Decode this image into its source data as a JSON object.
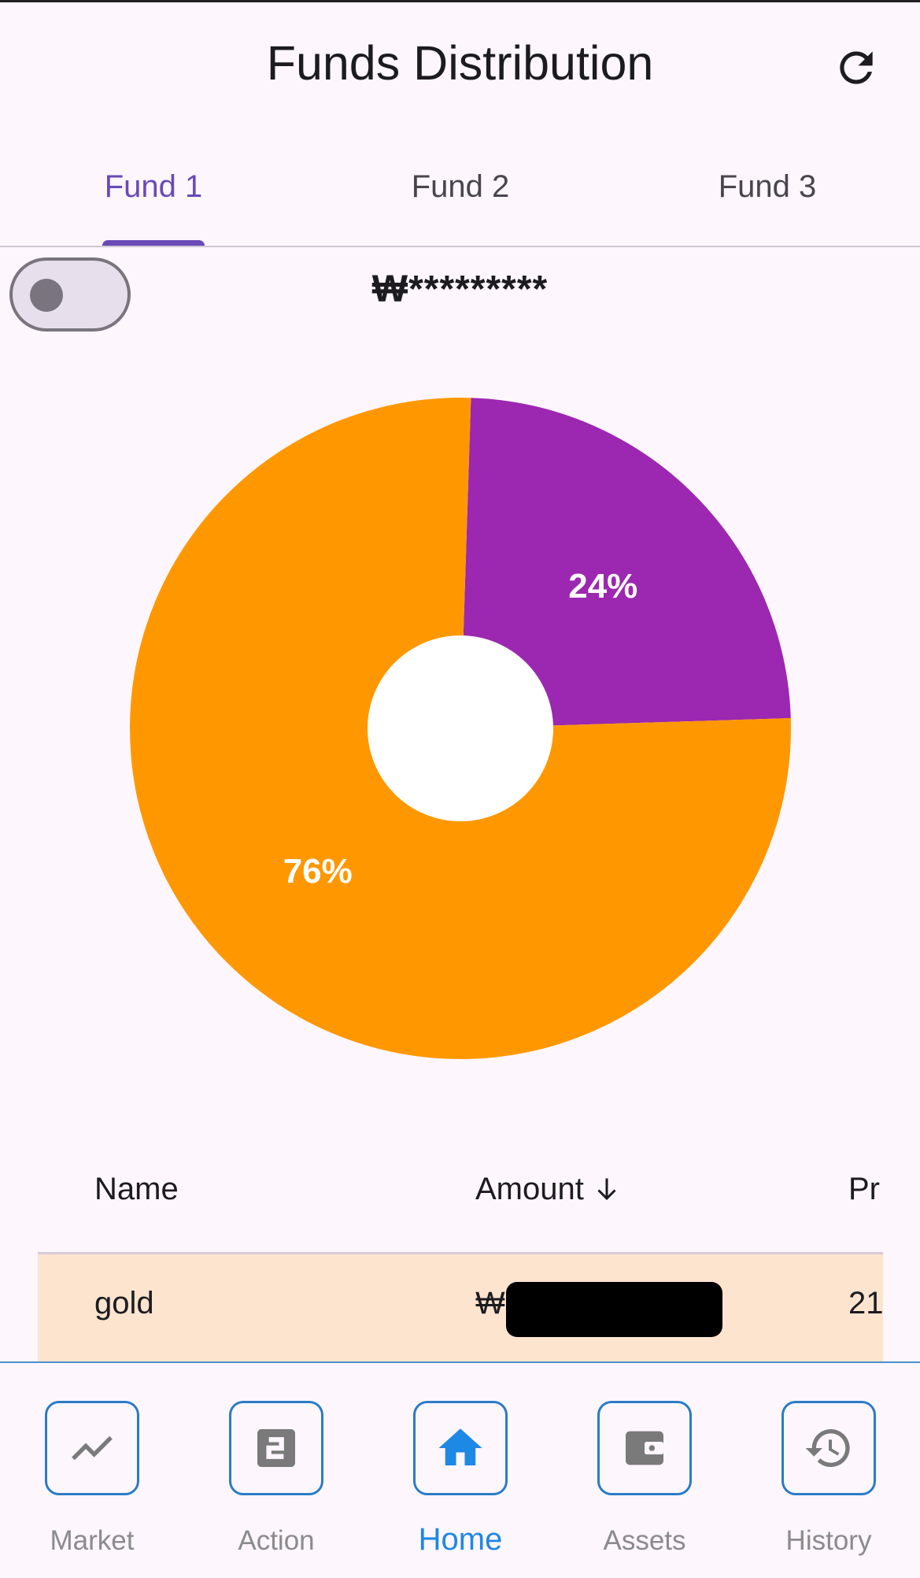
{
  "appbar": {
    "title": "Funds Distribution"
  },
  "tabs": [
    {
      "label": "Fund 1",
      "active": true
    },
    {
      "label": "Fund 2",
      "active": false
    },
    {
      "label": "Fund 3",
      "active": false
    }
  ],
  "balance": {
    "text": "₩*********",
    "hidden_toggle_on": false
  },
  "chart_data": {
    "type": "pie",
    "style": "donut",
    "slices": [
      {
        "value": 24,
        "label": "24%",
        "color": "#9c27b0"
      },
      {
        "value": 76,
        "label": "76%",
        "color": "#ff9800"
      }
    ]
  },
  "table": {
    "columns": [
      "Name",
      "Amount",
      "Pr"
    ],
    "sort": {
      "column": "Amount",
      "direction": "desc"
    },
    "rows": [
      {
        "name": "gold",
        "amount": "₩3",
        "col3": "21"
      }
    ]
  },
  "nav": {
    "items": [
      {
        "label": "Market",
        "icon": "trending-up-icon",
        "active": false
      },
      {
        "label": "Action",
        "icon": "action-2-icon",
        "active": false
      },
      {
        "label": "Home",
        "icon": "home-icon",
        "active": true
      },
      {
        "label": "Assets",
        "icon": "wallet-icon",
        "active": false
      },
      {
        "label": "History",
        "icon": "history-icon",
        "active": false
      }
    ]
  },
  "colors": {
    "background": "#fdf6fd",
    "primary": "#6a4ab5",
    "nav_active": "#1e88e5",
    "row_highlight": "#fde4cf"
  }
}
